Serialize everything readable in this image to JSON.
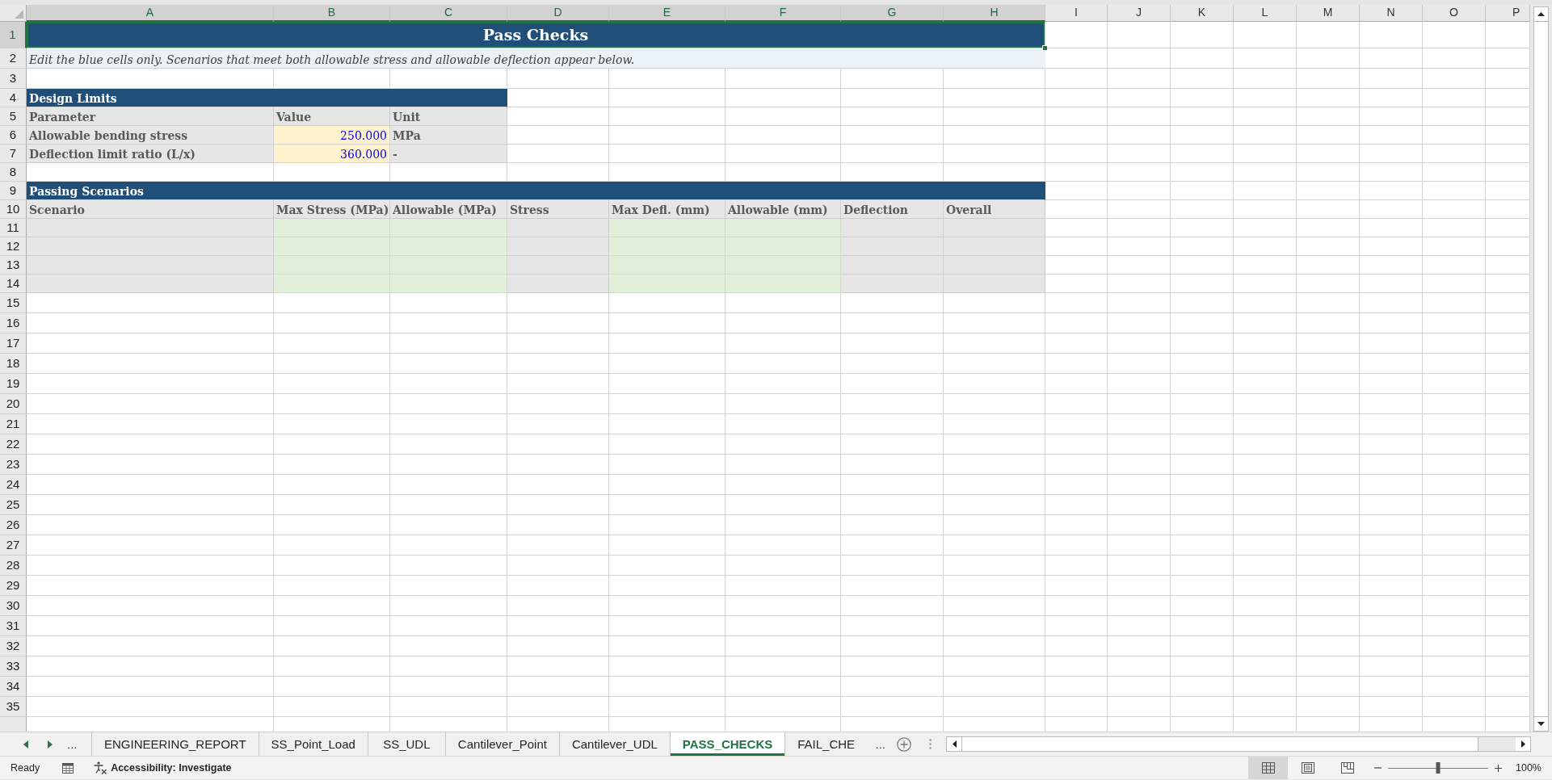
{
  "column_headers": [
    {
      "label": "A",
      "selected": true
    },
    {
      "label": "B",
      "selected": true
    },
    {
      "label": "C",
      "selected": true
    },
    {
      "label": "D",
      "selected": true
    },
    {
      "label": "E",
      "selected": true
    },
    {
      "label": "F",
      "selected": true
    },
    {
      "label": "G",
      "selected": true
    },
    {
      "label": "H",
      "selected": true
    },
    {
      "label": "I",
      "selected": false
    },
    {
      "label": "J",
      "selected": false
    },
    {
      "label": "K",
      "selected": false
    },
    {
      "label": "L",
      "selected": false
    },
    {
      "label": "M",
      "selected": false
    },
    {
      "label": "N",
      "selected": false
    },
    {
      "label": "O",
      "selected": false
    },
    {
      "label": "P",
      "selected": false
    }
  ],
  "row_headers": [
    {
      "label": "1",
      "selected": true
    },
    {
      "label": "2",
      "selected": false
    },
    {
      "label": "3",
      "selected": false
    },
    {
      "label": "4",
      "selected": false
    },
    {
      "label": "5",
      "selected": false
    },
    {
      "label": "6",
      "selected": false
    },
    {
      "label": "7",
      "selected": false
    },
    {
      "label": "8",
      "selected": false
    },
    {
      "label": "9",
      "selected": false
    },
    {
      "label": "10",
      "selected": false
    },
    {
      "label": "11",
      "selected": false
    },
    {
      "label": "12",
      "selected": false
    },
    {
      "label": "13",
      "selected": false
    },
    {
      "label": "14",
      "selected": false
    },
    {
      "label": "15",
      "selected": false
    },
    {
      "label": "16",
      "selected": false
    },
    {
      "label": "17",
      "selected": false
    },
    {
      "label": "18",
      "selected": false
    },
    {
      "label": "19",
      "selected": false
    },
    {
      "label": "20",
      "selected": false
    },
    {
      "label": "21",
      "selected": false
    },
    {
      "label": "22",
      "selected": false
    },
    {
      "label": "23",
      "selected": false
    },
    {
      "label": "24",
      "selected": false
    },
    {
      "label": "25",
      "selected": false
    },
    {
      "label": "26",
      "selected": false
    },
    {
      "label": "27",
      "selected": false
    },
    {
      "label": "28",
      "selected": false
    },
    {
      "label": "29",
      "selected": false
    },
    {
      "label": "30",
      "selected": false
    },
    {
      "label": "31",
      "selected": false
    },
    {
      "label": "32",
      "selected": false
    },
    {
      "label": "33",
      "selected": false
    },
    {
      "label": "34",
      "selected": false
    },
    {
      "label": "35",
      "selected": false
    }
  ],
  "title": {
    "text": "Pass Checks",
    "selected": true
  },
  "instructions": "Edit the blue cells only. Scenarios that meet both allowable stress and allowable deflection appear below.",
  "design_limits": {
    "heading": "Design Limits",
    "columns": [
      "Parameter",
      "Value",
      "Unit"
    ],
    "rows": [
      {
        "parameter": "Allowable bending stress",
        "value": "250.000",
        "unit": "MPa"
      },
      {
        "parameter": "Deflection limit ratio (L/x)",
        "value": "360.000",
        "unit": "-"
      }
    ]
  },
  "passing_scenarios": {
    "heading": "Passing Scenarios",
    "columns": [
      {
        "label": "Scenario",
        "kind": "text"
      },
      {
        "label": "Max Stress (MPa)",
        "kind": "number"
      },
      {
        "label": "Allowable (MPa)",
        "kind": "number"
      },
      {
        "label": "Stress",
        "kind": "check"
      },
      {
        "label": "Max Defl. (mm)",
        "kind": "number"
      },
      {
        "label": "Allowable (mm)",
        "kind": "number"
      },
      {
        "label": "Deflection",
        "kind": "check"
      },
      {
        "label": "Overall",
        "kind": "check"
      }
    ]
  },
  "sheet_tabs": {
    "more_before": "...",
    "tabs": [
      {
        "label": "ENGINEERING_REPORT",
        "selected": false
      },
      {
        "label": "SS_Point_Load",
        "selected": false
      },
      {
        "label": "SS_UDL",
        "selected": false
      },
      {
        "label": "Cantilever_Point",
        "selected": false
      },
      {
        "label": "Cantilever_UDL",
        "selected": false
      },
      {
        "label": "PASS_CHECKS",
        "selected": true
      },
      {
        "label": "FAIL_CHE",
        "selected": false
      }
    ],
    "more_after": "..."
  },
  "status_bar": {
    "status": "Ready",
    "accessibility": "Accessibility: Investigate",
    "views": [
      {
        "kind": "normal",
        "selected": true
      },
      {
        "kind": "page_layout",
        "selected": false
      },
      {
        "kind": "page_break",
        "selected": false
      }
    ],
    "zoom": {
      "level": 0.5,
      "reading": "100%"
    }
  }
}
